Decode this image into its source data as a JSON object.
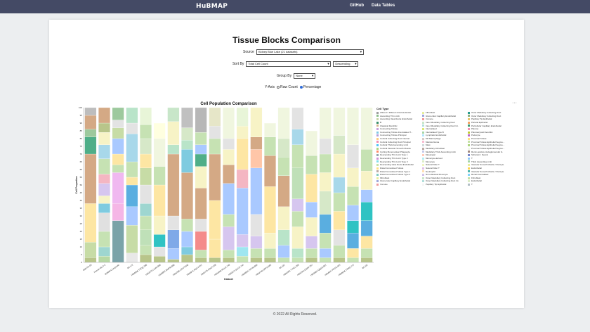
{
  "nav": {
    "logo": "HuBMAP",
    "links": [
      "GitHub",
      "Data Tables"
    ]
  },
  "page": {
    "title": "Tissue Blocks Comparison",
    "source_label": "Source",
    "source_value": "Kidney Blue Lake (21 datasets)",
    "sortby_label": "Sort By",
    "sortby_value": "Total Cell Count",
    "sortorder_value": "Descending",
    "groupby_label": "Group By",
    "groupby_value": "None",
    "yaxis_label": "Y-Axis",
    "yaxis_options": [
      "Raw Count",
      "Percentage"
    ],
    "yaxis_selected": "Percentage",
    "footer": "© 2022 All Rights Reserved.",
    "menu_glyph": "···"
  },
  "colors": {
    "nav_bg": "#444a65",
    "radio_selected": "#2f6bd8"
  },
  "chart_data": {
    "type": "bar",
    "stacked": true,
    "title": "Cell Population Comparison",
    "xlabel": "Dataset",
    "ylabel": "Cell Proportion",
    "ylim": [
      0,
      100
    ],
    "yticks": [
      0,
      5,
      10,
      15,
      20,
      25,
      30,
      35,
      40,
      45,
      50,
      55,
      60,
      65,
      70,
      75,
      80,
      85,
      90,
      95,
      100
    ],
    "categories": [
      "605725-00",
      "Human-BL-0-2",
      "605b8f-Composite",
      "85-172",
      "HBM966.TRDQ.386",
      "HBM376.LLM4.866",
      "HBM893.MMPB.886",
      "HBM395.ZWVT.946",
      "HBM974.KQVV.557",
      "HBM735.PDLP.338",
      "HBM456.RCLE.748",
      "HBM274.BCVF.744",
      "HBM694.HXHM.884",
      "HBM746.SRPZ.684",
      "85-187",
      "HBM555.TYXG.268",
      "HBM344.GBRF.357",
      "HBM664.QQSR.867",
      "HBM837.RFCB.463",
      "HBM646.TPMD.737",
      "85-197"
    ],
    "legend_title": "Cell Type",
    "legend_columns": [
      [
        "Afferent / Efferent Arteriole Endot.",
        "Ascending Thin Limb",
        "Ascending Vasa Recta Endothelial",
        "B",
        "Classical Dendritic",
        "Connecting Tubule",
        "Connecting Tubule Intercalated T...",
        "Connecting Tubule Principal",
        "Cortical Collecting Duct Intercal.",
        "Cortical Collecting Duct Principal",
        "Cortical Thick Ascending Limb",
        "Cortical Vascular Smooth Muscle",
        "Cycling Mononuclear Phagocyte",
        "Descending Thin Limb Type 1",
        "Descending Thin Limb Type 2",
        "Descending Thin Limb Type 3",
        "Descending Vasa Recta Endothelial",
        "Distal Convoluted Tubule",
        "Distal Convoluted Tubule Type 1",
        "Distal Convoluted Tubule Type 2",
        "Fibroblast",
        "Glomerular Capillary Endothelial",
        "Immune"
      ],
      [
        "Fibroblast",
        "Glomerular Capillary Endothelial",
        "Immune",
        "Inner Medullary Collecting Duct",
        "Inner Medullary Collecting Duct Int.",
        "Intercalated",
        "Intercalated Type B",
        "Lymphatic Endothelial",
        "M2 Macrophage",
        "Macula Densa",
        "Mast",
        "Medullary Fibroblast",
        "Medullary Thick Ascending Limb",
        "Mesangial",
        "Monocyte-derived",
        "Monocyte",
        "Natural Killer T",
        "Natural Killer T",
        "Neutrophil",
        "Non-classical Monocyte",
        "Outer Medullary Collecting Duct",
        "Outer Medullary Collecting Duct Int.",
        "Papillary Tip Epithelial"
      ],
      [
        "Outer Medullary Collecting Duct",
        "Outer Medullary Collecting Duct",
        "Papillary Tip Epithelial",
        "Parietal Epithelial",
        "Peritubular Capillary Endothelial",
        "Plasma",
        "Plasmacytoid Dendritic",
        "Podocyte",
        "Proximal Tubule",
        "Proximal Tubule Epithelial Segme...",
        "Proximal Tubule Epithelial Segme...",
        "Proximal Tubule Epithelial Segme...",
        "Renin-positive Juxtaglomerular G.",
        "Schwann / Neural",
        "T",
        "Thick Ascending Limb",
        "Vascular Smooth Muscle / Pericyte",
        "Endothelial",
        "Vascular Smooth Muscle / Pericyte",
        "Renal Intercalated",
        "Fibroblast",
        "Endothelial",
        "T"
      ]
    ],
    "legend_colors": [
      [
        "#9e9e9e",
        "#8bbf8b",
        "#c7d7a8",
        "#3a8f6a",
        "#d4b48c",
        "#c9a0dc",
        "#7ec8e3",
        "#b39ddb",
        "#ffcc80",
        "#f48fb1",
        "#4fc3f7",
        "#aed581",
        "#ff8a65",
        "#90a4ae",
        "#ce93d8",
        "#80deea",
        "#c5e1a5",
        "#ffe082",
        "#bcaaa4",
        "#80cbc4",
        "#e6ee9c",
        "#9fa8da",
        "#ef9a9a"
      ],
      [
        "#e6ee9c",
        "#9fa8da",
        "#ef9a9a",
        "#c8e6c9",
        "#b2dfdb",
        "#dce775",
        "#a5d6a7",
        "#b3e5fc",
        "#d7ccc8",
        "#f8bbd0",
        "#cfd8dc",
        "#bcaaa4",
        "#c5cae9",
        "#ffccbc",
        "#b2ebf2",
        "#dcedc8",
        "#f0f4c3",
        "#e1bee7",
        "#ffe0b2",
        "#d1c4e9",
        "#c8e6c9",
        "#b2dfdb",
        "#f5f5f5"
      ],
      [
        "#2a9d8f",
        "#8ab17d",
        "#e9c46a",
        "#f4a261",
        "#3d9970",
        "#f48fb1",
        "#c0ca33",
        "#ba68c8",
        "#ffe082",
        "#c5e1a5",
        "#aed581",
        "#f1f8e9",
        "#a1887f",
        "#7986cb",
        "#90caf9",
        "#a5d6a7",
        "#e6ee9c",
        "#ffd54f",
        "#4db6ac",
        "#81d4fa",
        "#c5e1a5",
        "#dcedc8",
        "#b0bec5"
      ]
    ],
    "series_colors": [
      "#e3e3e3",
      "#a8d8ea",
      "#c6e2b3",
      "#fde6a3",
      "#f4b6c2",
      "#bfa0d8",
      "#7fcbe0",
      "#ffd59e",
      "#d4a985",
      "#b9e4c9",
      "#f7f3c6",
      "#a9c9ff",
      "#ffc6a8",
      "#cfd8dc",
      "#b7b7b7",
      "#8fc98f",
      "#9ed6d0",
      "#e8a87c",
      "#d6c6ef",
      "#6fb3d2",
      "#c2b280"
    ],
    "stacks": [
      [
        [
          3,
          "#b8c58a"
        ],
        [
          10,
          "#c7dca6"
        ],
        [
          25,
          "#fde6a3"
        ],
        [
          32,
          "#d4a985"
        ],
        [
          11,
          "#4fae88"
        ],
        [
          5,
          "#9dc99d"
        ],
        [
          9,
          "#d4a985"
        ],
        [
          5,
          "#bdbdbd"
        ]
      ],
      [
        [
          4,
          "#b7d8a4"
        ],
        [
          6,
          "#9ed6d0"
        ],
        [
          10,
          "#c6e2b3"
        ],
        [
          12,
          "#e0e0e0"
        ],
        [
          6,
          "#7fcbe0"
        ],
        [
          5,
          "#f7f3c6"
        ],
        [
          8,
          "#d6c6ef"
        ],
        [
          6,
          "#f4b6c2"
        ],
        [
          10,
          "#c6e2b3"
        ],
        [
          9,
          "#a8d8ea"
        ],
        [
          8,
          "#f7f3c6"
        ],
        [
          6,
          "#b8c58a"
        ],
        [
          10,
          "#d4a985"
        ]
      ],
      [
        [
          27,
          "#7aa3a8"
        ],
        [
          11,
          "#f5b6e6"
        ],
        [
          20,
          "#f0b8f0"
        ],
        [
          5,
          "#c6e2b3"
        ],
        [
          7,
          "#fde6a3"
        ],
        [
          10,
          "#a9c9ff"
        ],
        [
          7,
          "#c7dca6"
        ],
        [
          5,
          "#e3e3e3"
        ],
        [
          8,
          "#9dc99d"
        ]
      ],
      [
        [
          6,
          "#e8e8e8"
        ],
        [
          18,
          "#c7dca6"
        ],
        [
          12,
          "#a9c9ff"
        ],
        [
          14,
          "#5aaee0"
        ],
        [
          5,
          "#fde6a3"
        ],
        [
          10,
          "#c6e2b3"
        ],
        [
          18,
          "#a8d8ea"
        ],
        [
          7,
          "#e3e3e3"
        ],
        [
          10,
          "#b9e4c9"
        ]
      ],
      [
        [
          5,
          "#b8c58a"
        ],
        [
          6,
          "#c6e2b3"
        ],
        [
          10,
          "#bfe0b8"
        ],
        [
          9,
          "#c6e2b3"
        ],
        [
          8,
          "#9ed6d0"
        ],
        [
          12,
          "#e3e3e3"
        ],
        [
          11,
          "#c7dca6"
        ],
        [
          9,
          "#fde6a3"
        ],
        [
          10,
          "#d6e8c8"
        ],
        [
          9,
          "#c6e2b3"
        ],
        [
          11,
          "#e8f5d8"
        ]
      ],
      [
        [
          4,
          "#b8c58a"
        ],
        [
          6,
          "#e3e3e3"
        ],
        [
          8,
          "#2fc3c3"
        ],
        [
          12,
          "#f7f3c6"
        ],
        [
          20,
          "#fde6a3"
        ],
        [
          12,
          "#c6e2b3"
        ],
        [
          18,
          "#f0f6df"
        ],
        [
          10,
          "#ffffe0"
        ],
        [
          10,
          "#ffffff"
        ]
      ],
      [
        [
          2,
          "#b8c58a"
        ],
        [
          7,
          "#a9c9ff"
        ],
        [
          12,
          "#7fa9e8"
        ],
        [
          9,
          "#e3e3e3"
        ],
        [
          40,
          "#d4a985"
        ],
        [
          6,
          "#b9e4c9"
        ],
        [
          15,
          "#f7f3c6"
        ],
        [
          9,
          "#c8e6c9"
        ]
      ],
      [
        [
          5,
          "#b8c58a"
        ],
        [
          5,
          "#7fcbe0"
        ],
        [
          10,
          "#a9c9ff"
        ],
        [
          8,
          "#c6e2b3"
        ],
        [
          30,
          "#d4a985"
        ],
        [
          15,
          "#7fcbe0"
        ],
        [
          6,
          "#b9e4c9"
        ],
        [
          8,
          "#d6e8c8"
        ],
        [
          13,
          "#c0c0c0"
        ]
      ],
      [
        [
          3,
          "#b8c58a"
        ],
        [
          5,
          "#c6e2b3"
        ],
        [
          12,
          "#f48b8b"
        ],
        [
          8,
          "#e3e3e3"
        ],
        [
          20,
          "#d4a985"
        ],
        [
          14,
          "#f7f3c6"
        ],
        [
          8,
          "#4fae88"
        ],
        [
          6,
          "#a9c9ff"
        ],
        [
          8,
          "#c6e2b3"
        ],
        [
          16,
          "#b7b7b7"
        ]
      ],
      [
        [
          3,
          "#b8c58a"
        ],
        [
          12,
          "#fde6a3"
        ],
        [
          25,
          "#fde6a3"
        ],
        [
          30,
          "#d4a985"
        ],
        [
          10,
          "#c6e2b3"
        ],
        [
          8,
          "#e3e3e3"
        ],
        [
          12,
          "#e6e6c8"
        ]
      ],
      [
        [
          3,
          "#b8c58a"
        ],
        [
          5,
          "#c6e2b3"
        ],
        [
          15,
          "#d6c6ef"
        ],
        [
          8,
          "#c6e2b3"
        ],
        [
          20,
          "#a9c9ff"
        ],
        [
          12,
          "#d4a985"
        ],
        [
          10,
          "#f7f3c6"
        ],
        [
          7,
          "#e3e3e3"
        ],
        [
          20,
          "#f0f6df"
        ]
      ],
      [
        [
          4,
          "#c6e2b3"
        ],
        [
          6,
          "#9fe6f0"
        ],
        [
          8,
          "#d6c6ef"
        ],
        [
          30,
          "#a9c9ff"
        ],
        [
          12,
          "#f4b6c2"
        ],
        [
          20,
          "#fde6a3"
        ],
        [
          8,
          "#f7f3c6"
        ],
        [
          12,
          "#e8f5d8"
        ]
      ],
      [
        [
          3,
          "#b8c58a"
        ],
        [
          6,
          "#c6e2b3"
        ],
        [
          8,
          "#d6c6ef"
        ],
        [
          14,
          "#e3e3e3"
        ],
        [
          30,
          "#a9c9ff"
        ],
        [
          12,
          "#ffc6a8"
        ],
        [
          8,
          "#d4a985"
        ],
        [
          19,
          "#f7f3c6"
        ]
      ],
      [
        [
          3,
          "#b8c58a"
        ],
        [
          6,
          "#c6e2b3"
        ],
        [
          10,
          "#f7f3c6"
        ],
        [
          30,
          "#fde6a3"
        ],
        [
          20,
          "#d4a985"
        ],
        [
          12,
          "#c6e2b3"
        ],
        [
          9,
          "#f0f6df"
        ],
        [
          10,
          "#ffffff"
        ]
      ],
      [
        [
          3,
          "#c6e2b3"
        ],
        [
          8,
          "#a9c9ff"
        ],
        [
          10,
          "#b9e4c9"
        ],
        [
          15,
          "#f7f3c6"
        ],
        [
          20,
          "#d4a985"
        ],
        [
          12,
          "#c6e2b3"
        ],
        [
          12,
          "#d6e8c8"
        ],
        [
          20,
          "#f0f6df"
        ]
      ],
      [
        [
          3,
          "#c6e2b3"
        ],
        [
          6,
          "#b9e4c9"
        ],
        [
          14,
          "#f7f3c6"
        ],
        [
          10,
          "#c6e2b3"
        ],
        [
          8,
          "#d6c6ef"
        ],
        [
          20,
          "#bfe0b8"
        ],
        [
          15,
          "#c6e2b3"
        ],
        [
          10,
          "#a8d8ea"
        ],
        [
          14,
          "#e3e3e3"
        ]
      ],
      [
        [
          3,
          "#b8c58a"
        ],
        [
          6,
          "#c6e2b3"
        ],
        [
          8,
          "#d6c6ef"
        ],
        [
          12,
          "#f7f3c6"
        ],
        [
          10,
          "#a9c9ff"
        ],
        [
          18,
          "#fde6a3"
        ],
        [
          12,
          "#c6e2b3"
        ],
        [
          16,
          "#f0f6df"
        ],
        [
          15,
          "#ffffff"
        ]
      ],
      [
        [
          3,
          "#c6e2b3"
        ],
        [
          6,
          "#a9c9ff"
        ],
        [
          10,
          "#c6e2b3"
        ],
        [
          12,
          "#5aaee0"
        ],
        [
          15,
          "#d6e8c8"
        ],
        [
          12,
          "#f7f3c6"
        ],
        [
          12,
          "#c6e2b3"
        ],
        [
          10,
          "#e3e3e3"
        ],
        [
          20,
          "#f0f6df"
        ]
      ],
      [
        [
          3,
          "#b8c58a"
        ],
        [
          8,
          "#c6e2b3"
        ],
        [
          10,
          "#e3e3e3"
        ],
        [
          12,
          "#fde6a3"
        ],
        [
          12,
          "#c6e2b3"
        ],
        [
          10,
          "#a8d8ea"
        ],
        [
          15,
          "#f7f3c6"
        ],
        [
          12,
          "#d6e8c8"
        ],
        [
          18,
          "#f0f6df"
        ]
      ],
      [
        [
          3,
          "#c6e2b3"
        ],
        [
          6,
          "#fde6a3"
        ],
        [
          10,
          "#5aaee0"
        ],
        [
          8,
          "#2fc3c3"
        ],
        [
          10,
          "#a9c9ff"
        ],
        [
          12,
          "#c6e2b3"
        ],
        [
          12,
          "#f7f3c6"
        ],
        [
          15,
          "#e3e3e3"
        ],
        [
          24,
          "#f0f6df"
        ]
      ],
      [
        [
          3,
          "#b8c58a"
        ],
        [
          6,
          "#c6e2b3"
        ],
        [
          8,
          "#fde6a3"
        ],
        [
          10,
          "#5aaee0"
        ],
        [
          12,
          "#2fc3c3"
        ],
        [
          8,
          "#a9c9ff"
        ],
        [
          12,
          "#f7f3c6"
        ],
        [
          14,
          "#c6e2b3"
        ],
        [
          27,
          "#f0f6df"
        ]
      ]
    ]
  }
}
